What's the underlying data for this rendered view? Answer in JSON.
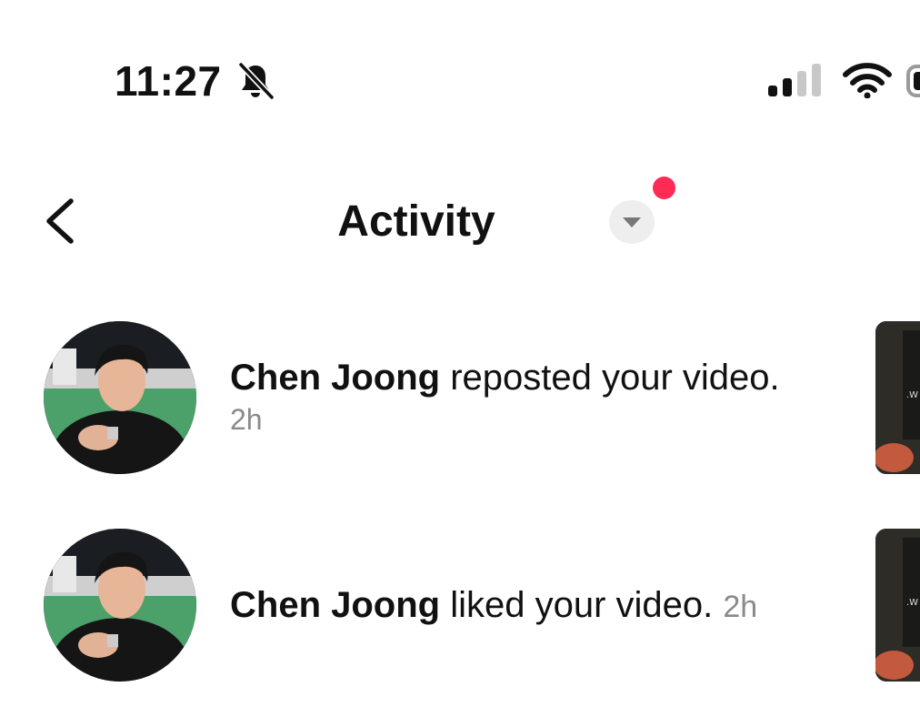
{
  "status_bar": {
    "time": "11:27",
    "icons": [
      "bell-slash-icon",
      "cellular-signal-icon",
      "wifi-icon",
      "battery-icon"
    ]
  },
  "header": {
    "title": "Activity",
    "back_icon": "chevron-left-icon",
    "dropdown_icon": "caret-down-icon",
    "notification_dot_color": "#ff2b55"
  },
  "activity": [
    {
      "user": "Chen Joong",
      "action": "reposted your video.",
      "time": "2h"
    },
    {
      "user": "Chen Joong",
      "action": "liked your video.",
      "time": "2h"
    }
  ],
  "colors": {
    "text": "#111111",
    "secondary_text": "#8a8a8a",
    "accent_dot": "#ff2b55"
  }
}
